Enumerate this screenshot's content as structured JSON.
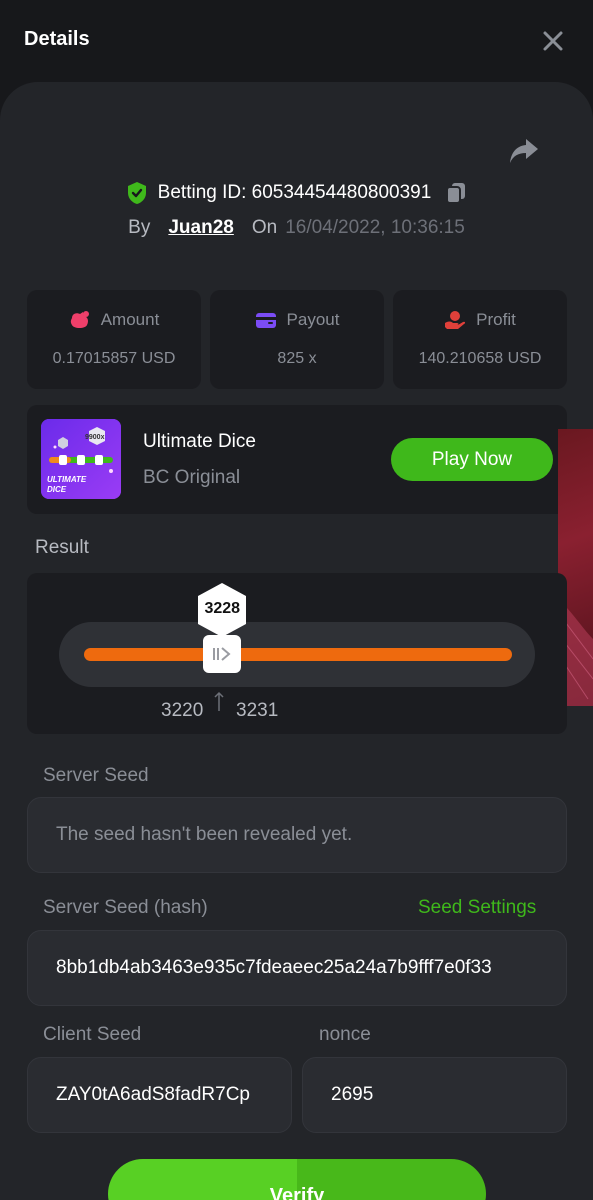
{
  "header": {
    "title": "Details"
  },
  "bet": {
    "id_label": "Betting ID: 605344544808003­91",
    "by_label": "By",
    "username": "Juan28",
    "on_label": "On",
    "datetime": "16/04/2022, 10:36:15"
  },
  "stats": [
    {
      "label": "Amount",
      "value": "0.17015857 USD",
      "icon": "money-bag-icon",
      "color": "#ef3f6a"
    },
    {
      "label": "Payout",
      "value": "825 x",
      "icon": "wallet-card-icon",
      "color": "#7b4cf5"
    },
    {
      "label": "Profit",
      "value": "140.210658 USD",
      "icon": "hand-coin-icon",
      "color": "#e0403a"
    }
  ],
  "game": {
    "name": "Ultimate Dice",
    "provider": "BC Original",
    "play_label": "Play Now",
    "thumb_badge": "9900x",
    "thumb_title_1": "ULTIMATE",
    "thumb_title_2": "DICE"
  },
  "result": {
    "label": "Result",
    "value": "3228",
    "range_min": "3220",
    "range_max": "3231",
    "slider_fraction": 0.323
  },
  "server_seed": {
    "label": "Server Seed",
    "value": "The seed hasn't been revealed yet."
  },
  "server_seed_hash": {
    "label": "Server Seed (hash)",
    "link": "Seed Settings",
    "value": "8bb1db4ab3463e935c7fdeaeec25a24a7b9fff7e0f33"
  },
  "client_seed": {
    "label": "Client Seed",
    "value": "ZAY0tA6adS8fadR7Cp"
  },
  "nonce": {
    "label": "nonce",
    "value": "2695"
  },
  "verify": {
    "label": "Verify"
  },
  "colors": {
    "accent_green": "#3fb81b",
    "orange": "#ee6a0e",
    "panel": "#232529"
  }
}
